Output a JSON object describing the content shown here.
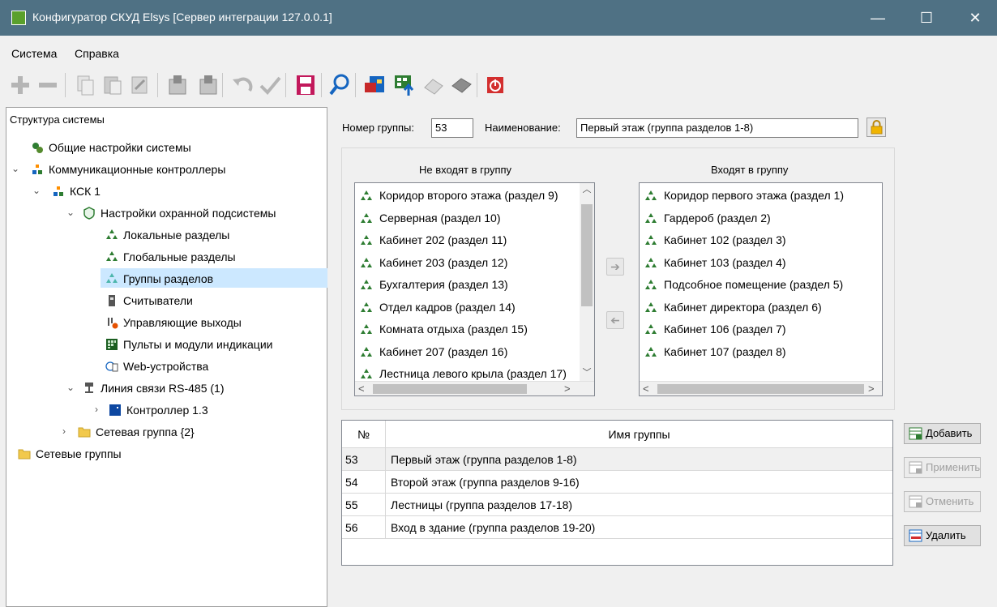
{
  "window": {
    "title": "Конфигуратор СКУД Elsys [Сервер интеграции 127.0.0.1]",
    "minimize": "—",
    "maximize": "☐",
    "close": "✕"
  },
  "menu": {
    "system": "Система",
    "help": "Справка"
  },
  "tree": {
    "header": "Структура системы",
    "nodes": {
      "general": "Общие настройки системы",
      "comm_controllers": "Коммуникационные контроллеры",
      "ksk": "КСК 1",
      "security": "Настройки охранной подсистемы",
      "local_partitions": "Локальные разделы",
      "global_partitions": "Глобальные разделы",
      "partition_groups": "Группы разделов",
      "readers": "Считыватели",
      "outputs": "Управляющие выходы",
      "panels": "Пульты и модули индикации",
      "web": "Web-устройства",
      "rs485": "Линия связи RS-485 (1)",
      "controller": "Контроллер 1.3",
      "net_group": "Сетевая группа {2}",
      "net_groups": "Сетевые группы"
    }
  },
  "form": {
    "group_number_label": "Номер группы:",
    "group_number": "53",
    "name_label": "Наименование:",
    "name_value": "Первый этаж (группа разделов 1-8)"
  },
  "lists": {
    "excluded_title": "Не входят в группу",
    "included_title": "Входят в группу",
    "excluded": [
      "Коридор второго этажа (раздел 9)",
      "Серверная (раздел 10)",
      "Кабинет 202 (раздел 11)",
      "Кабинет 203 (раздел 12)",
      "Бухгалтерия (раздел 13)",
      "Отдел кадров (раздел 14)",
      "Комната отдыха (раздел 15)",
      "Кабинет 207 (раздел 16)",
      "Лестница левого крыла (раздел 17)"
    ],
    "included": [
      "Коридор первого этажа (раздел 1)",
      "Гардероб (раздел 2)",
      "Кабинет 102 (раздел 3)",
      "Кабинет 103 (раздел 4)",
      "Подсобное помещение (раздел 5)",
      "Кабинет директора (раздел 6)",
      "Кабинет 106 (раздел 7)",
      "Кабинет 107 (раздел 8)"
    ]
  },
  "grid": {
    "col_num": "№",
    "col_name": "Имя группы",
    "rows": [
      {
        "num": "53",
        "name": "Первый этаж (группа разделов 1-8)"
      },
      {
        "num": "54",
        "name": "Второй этаж (группа разделов 9-16)"
      },
      {
        "num": "55",
        "name": "Лестницы (группа разделов 17-18)"
      },
      {
        "num": "56",
        "name": "Вход в здание (группа разделов 19-20)"
      }
    ]
  },
  "buttons": {
    "add": "Добавить",
    "apply": "Применить",
    "cancel": "Отменить",
    "delete": "Удалить"
  },
  "colors": {
    "titlebar": "#4f7184",
    "selection": "#cce8ff",
    "tree_icon_green": "#2e7d32"
  }
}
